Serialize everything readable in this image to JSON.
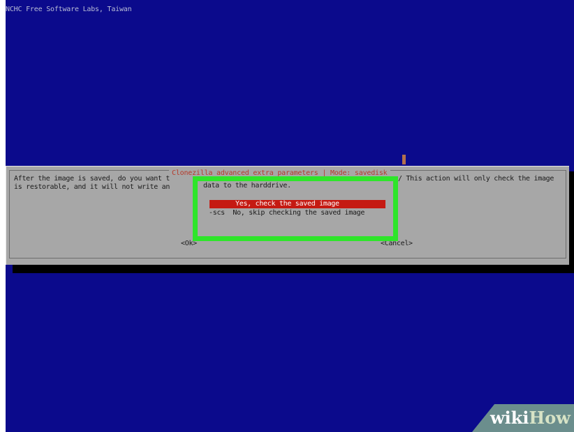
{
  "colors": {
    "screen_background": "#0b0a8c",
    "dialog_background": "#a7a7a7",
    "title_red": "#b63a2b",
    "selected_option_bg": "#c51a12",
    "highlight_box_green": "#2ee52a",
    "watermark_bg": "#6b8e8d"
  },
  "top_banner": "NCHC Free Software Labs, Taiwan",
  "dialog": {
    "title": "Clonezilla advanced extra parameters | Mode: savedisk",
    "line1_left": "After the image is saved, do you want t",
    "line2_left": "is restorable, and it will not write an",
    "line1_right": "/ This action will only check the image",
    "ok_label": "<Ok>",
    "cancel_label": "<Cancel>"
  },
  "highlight": {
    "text": "data to the harddrive.",
    "options": [
      {
        "tag": "",
        "label": "Yes, check the saved image",
        "selected": true
      },
      {
        "tag": "-scs",
        "label": "No, skip checking the saved image",
        "selected": false
      }
    ]
  },
  "watermark": {
    "wiki": "wiki",
    "how": "How"
  }
}
